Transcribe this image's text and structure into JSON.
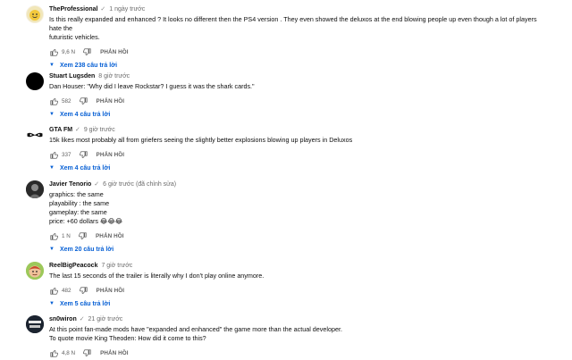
{
  "actions": {
    "reply_label": "PHẢN HỒI"
  },
  "colors": {
    "link": "#065fd4",
    "meta": "#606060",
    "text": "#0f0f0f"
  },
  "comments": [
    {
      "author": "TheProfessional",
      "verified": "✓",
      "time": "1 ngày trước",
      "text": "Is this really expanded and enhanced ? It looks no different then the PS4 version . They even showed the deluxos at the end blowing people up even though a lot of players hate the\nfuturistic vehicles.",
      "likes": "9,6 N",
      "replies": "Xem 238 câu trả lời",
      "avatar": "smiley-icon"
    },
    {
      "author": "Stuart Lugsden",
      "time": "8 giờ trước",
      "text": "Dan Houser: \"Why did I leave Rockstar? I guess it was the shark cards.\"",
      "likes": "582",
      "replies": "Xem 4 câu trả lời",
      "avatar": "black-circle"
    },
    {
      "author": "GTA FM",
      "verified": "✓",
      "time": "9 giờ trước",
      "text": "15k likes most probably all from griefers seeing the slightly better explosions blowing up players in Deluxos",
      "likes": "337",
      "replies": "Xem 4 câu trả lời",
      "avatar": "mask-logo"
    },
    {
      "author": "Javier Tenorio",
      "verified": "✓",
      "time": "6 giờ trước (đã chỉnh sửa)",
      "text": "graphics: the same\nplayability : the same\ngameplay: the same\nprice: +60 dollars 😂😂😂",
      "likes": "1 N",
      "replies": "Xem 20 câu trả lời",
      "avatar": "photo-avatar"
    },
    {
      "author": "ReelBigPeacock",
      "time": "7 giờ trước",
      "text": "The last 15 seconds of the trailer is literally why I don't play online anymore.",
      "likes": "482",
      "replies": "Xem 5 câu trả lời",
      "avatar": "cartoon-face"
    },
    {
      "author": "sn0wiron",
      "verified": "✓",
      "time": "21 giờ trước",
      "text": "At this point fan-made mods have \"expanded and enhanced\" the game more than the actual developer.\nTo quote movie King Theoden: How did it come to this?",
      "likes": "4,8 N",
      "avatar": "text-logo"
    }
  ]
}
